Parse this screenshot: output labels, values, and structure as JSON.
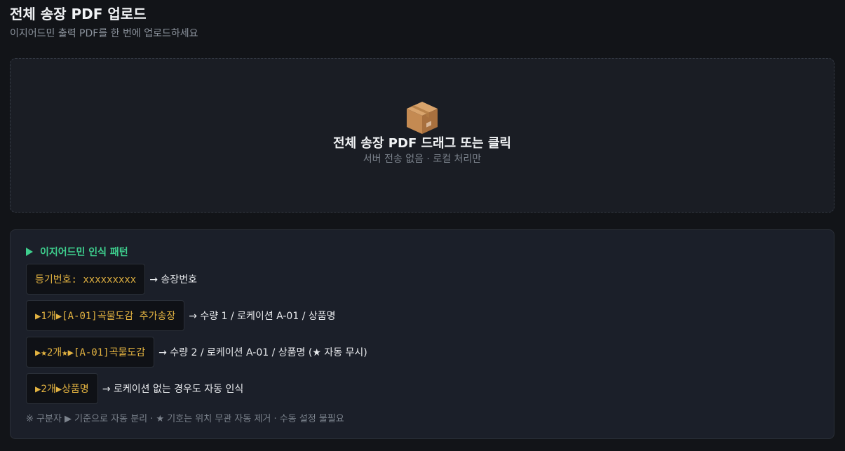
{
  "header": {
    "title": "전체 송장 PDF 업로드",
    "subtitle": "이지어드민 출력 PDF를 한 번에 업로드하세요"
  },
  "dropzone": {
    "icon": "package-box-icon",
    "title": "전체 송장 PDF 드래그 또는 클릭",
    "subtitle": "서버 전송 없음 · 로컬 처리만"
  },
  "patterns": {
    "heading": "이지어드민 인식 패턴",
    "rows": [
      {
        "code": "등기번호: xxxxxxxxx",
        "desc": "→ 송장번호"
      },
      {
        "code": "▶1개▶[A-01]곡물도감 추가송장",
        "desc": "→ 수량 1 / 로케이션 A-01 / 상품명"
      },
      {
        "code": "▶★2개★▶[A-01]곡물도감",
        "desc": "→ 수량 2 / 로케이션 A-01 / 상품명 (★ 자동 무시)"
      },
      {
        "code": "▶2개▶상품명",
        "desc": "→ 로케이션 없는 경우도 자동 인식"
      }
    ],
    "footnote": "※ 구분자 ▶ 기준으로 자동 분리 · ★ 기호는 위치 무관 자동 제거 · 수동 설정 불필요"
  },
  "colors": {
    "background": "#121418",
    "accent_green": "#3ecf8e",
    "code_yellow": "#e3b341"
  }
}
